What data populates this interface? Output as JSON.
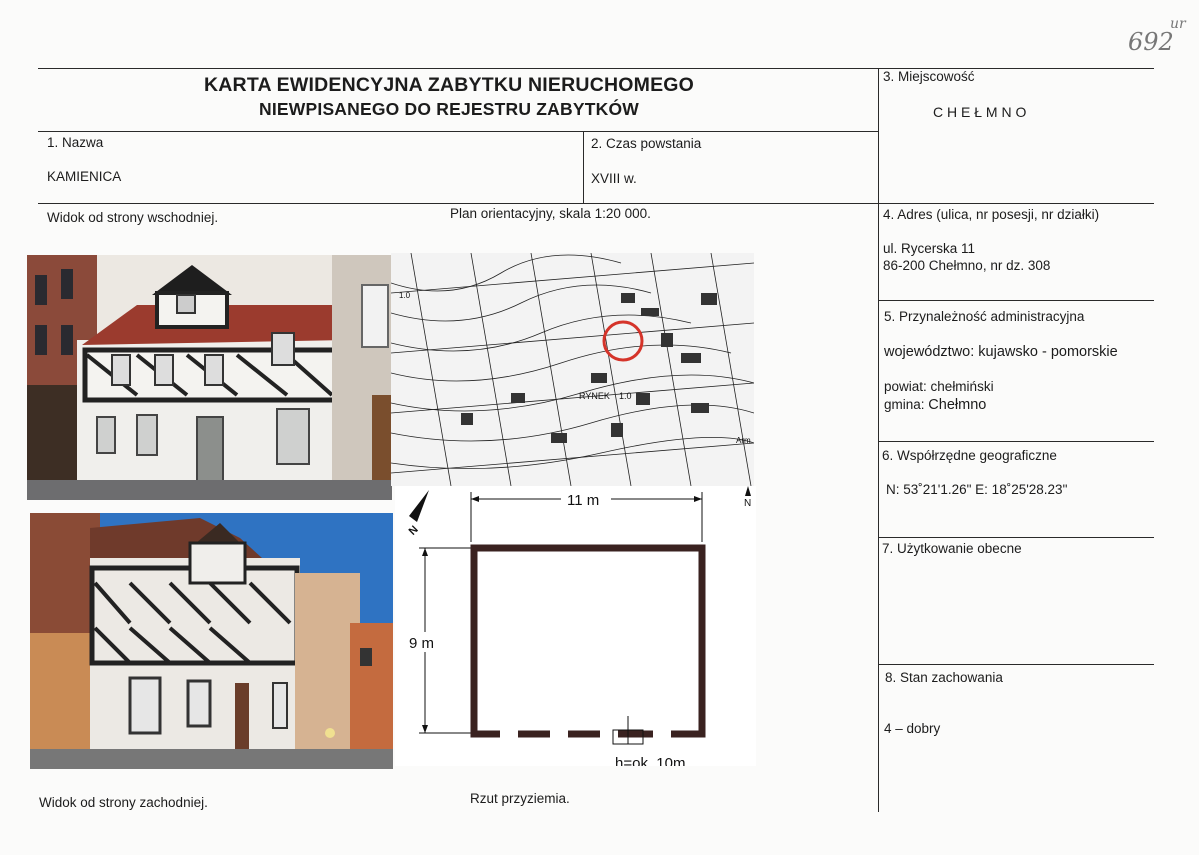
{
  "header": {
    "title_line1": "KARTA EWIDENCYJNA ZABYTKU NIERUCHOMEGO",
    "title_line2": "NIEWPISANEGO DO REJESTRU ZABYTKÓW"
  },
  "annotation": {
    "number": "692",
    "initials": "ur"
  },
  "fields": {
    "name": {
      "label": "1. Nazwa",
      "value": "KAMIENICA"
    },
    "origin": {
      "label": "2. Czas powstania",
      "value": "XVIII w."
    },
    "locality": {
      "label": "3. Miejscowość",
      "value": "C H E Ł M N O"
    },
    "address": {
      "label": "4. Adres (ulica, nr posesji, nr działki)",
      "line1": "ul.  Rycerska 11",
      "line2": "86-200 Chełmno, nr dz. 308"
    },
    "admin": {
      "label": "5. Przynależność administracyjna",
      "voivodeship_key": "województwo:",
      "voivodeship_val": "kujawsko - pomorskie",
      "county_key": "powiat:",
      "county_val": "chełmiński",
      "commune_key": "gmina:",
      "commune_val": "Chełmno"
    },
    "coords": {
      "label": "6. Współrzędne geograficzne",
      "value": "N: 53˚21'1.26\" E: 18˚25'28.23\""
    },
    "usage": {
      "label": "7. Użytkowanie obecne",
      "value": ""
    },
    "condition": {
      "label": "8. Stan zachowania",
      "value": "4 – dobry"
    }
  },
  "captions": {
    "east_view": "Widok od strony wschodniej.",
    "plan": "Plan orientacyjny, skala 1:20 000.",
    "west_view": "Widok od strony zachodniej.",
    "ground_plan": "Rzut przyziemia."
  },
  "map": {
    "rynek_label": "RYNEK",
    "rynek_num": "1.0",
    "num_label": "1.0",
    "arm_label": "Arm",
    "north": "N"
  },
  "floorplan": {
    "width_label": "11 m",
    "height_label": "9 m",
    "bottom_label": "h=ok. 10m",
    "north": "N"
  }
}
